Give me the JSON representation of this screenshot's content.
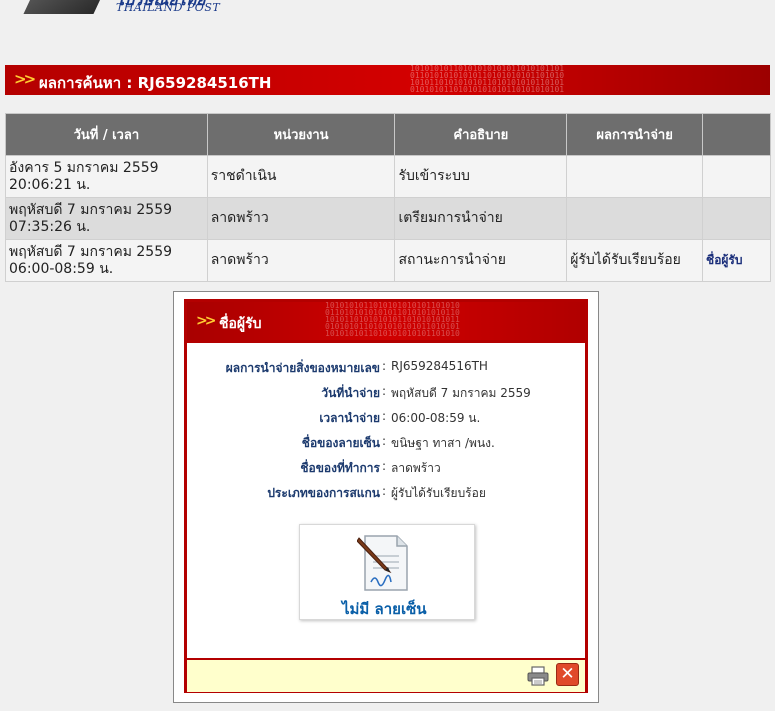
{
  "logo": {
    "thai_text": "ไปรษณีย์ไทย",
    "english_text": "THAILAND POST"
  },
  "result_banner": {
    "text": "ผลการค้นหา : RJ659284516TH"
  },
  "table": {
    "headers": [
      "วันที่ / เวลา",
      "หน่วยงาน",
      "คำอธิบาย",
      "ผลการนำจ่าย",
      ""
    ],
    "rows": [
      {
        "date": "อังคาร 5 มกราคม 2559",
        "time": "20:06:21 น.",
        "office": "ราชดำเนิน",
        "description": "รับเข้าระบบ",
        "result": "",
        "link": ""
      },
      {
        "date": "พฤหัสบดี 7 มกราคม 2559",
        "time": "07:35:26 น.",
        "office": "ลาดพร้าว",
        "description": "เตรียมการนำจ่าย",
        "result": "",
        "link": ""
      },
      {
        "date": "พฤหัสบดี 7 มกราคม 2559",
        "time": "06:00-08:59 น.",
        "office": "ลาดพร้าว",
        "description": "สถานะการนำจ่าย",
        "result": "ผู้รับได้รับเรียบร้อย",
        "link": "ชื่อผู้รับ"
      }
    ]
  },
  "popup": {
    "title": "ชื่อผู้รับ",
    "details": [
      {
        "label": "ผลการนำจ่ายสิ่งของหมายเลข",
        "value": "RJ659284516TH"
      },
      {
        "label": "วันที่นำจ่าย",
        "value": "พฤหัสบดี 7 มกราคม 2559"
      },
      {
        "label": "เวลานำจ่าย",
        "value": "06:00-08:59 น."
      },
      {
        "label": "ชื่อของลายเซ็น",
        "value": "ขนิษฐา ทาสา /พนง."
      },
      {
        "label": "ชื่อของที่ทำการ",
        "value": "ลาดพร้าว"
      },
      {
        "label": "ประเภทของการสแกน",
        "value": "ผู้รับได้รับเรียบร้อย"
      }
    ],
    "colon": ":",
    "signature_text": "ไม่มี ลายเซ็น",
    "print_icon": "printer-icon",
    "close_icon": "close-icon"
  },
  "colors": {
    "banner_red": "#c00000",
    "header_gray": "#6e6e6e",
    "footer_yellow": "#ffffcc",
    "label_blue": "#1c3a6e"
  }
}
